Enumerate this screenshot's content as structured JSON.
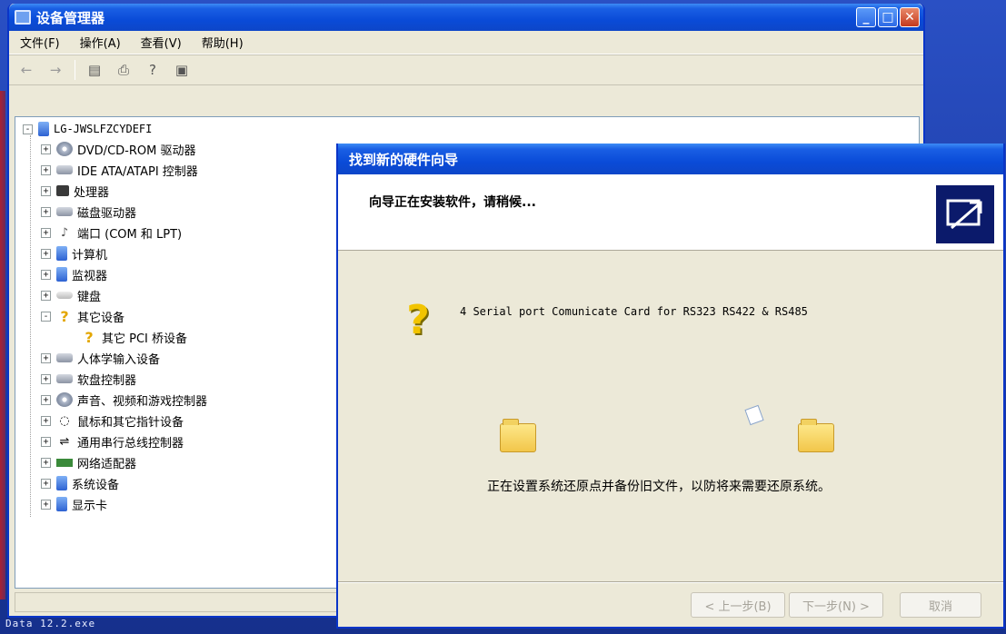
{
  "device_manager": {
    "title": "设备管理器",
    "menu": [
      "文件(F)",
      "操作(A)",
      "查看(V)",
      "帮助(H)"
    ],
    "toolbar": {
      "back_icon": "back-arrow-icon",
      "forward_icon": "forward-arrow-icon",
      "icons": [
        "properties-icon",
        "print-icon",
        "help-icon",
        "refresh-icon"
      ]
    },
    "tree": {
      "root": "LG-JWSLFZCYDEFI",
      "items": [
        {
          "label": "DVD/CD-ROM 驱动器",
          "icon": "disk-icon",
          "expander": "+"
        },
        {
          "label": "IDE ATA/ATAPI 控制器",
          "icon": "drive-icon",
          "expander": "+"
        },
        {
          "label": "处理器",
          "icon": "chip-icon",
          "expander": "+"
        },
        {
          "label": "磁盘驱动器",
          "icon": "drive-icon",
          "expander": "+"
        },
        {
          "label": "端口 (COM 和 LPT)",
          "icon": "port-icon",
          "expander": "+"
        },
        {
          "label": "计算机",
          "icon": "monitor-icon",
          "expander": "+"
        },
        {
          "label": "监视器",
          "icon": "monitor-icon",
          "expander": "+"
        },
        {
          "label": "键盘",
          "icon": "keyboard-icon",
          "expander": "+"
        },
        {
          "label": "其它设备",
          "icon": "question-icon",
          "expander": "-"
        },
        {
          "label": "其它 PCI 桥设备",
          "icon": "question-icon",
          "expander": ""
        },
        {
          "label": "人体学输入设备",
          "icon": "hid-icon",
          "expander": "+"
        },
        {
          "label": "软盘控制器",
          "icon": "drive-icon",
          "expander": "+"
        },
        {
          "label": "声音、视频和游戏控制器",
          "icon": "sound-icon",
          "expander": "+"
        },
        {
          "label": "鼠标和其它指针设备",
          "icon": "mouse-icon",
          "expander": "+"
        },
        {
          "label": "通用串行总线控制器",
          "icon": "usb-icon",
          "expander": "+"
        },
        {
          "label": "网络适配器",
          "icon": "network-icon",
          "expander": "+"
        },
        {
          "label": "系统设备",
          "icon": "monitor-icon",
          "expander": "+"
        },
        {
          "label": "显示卡",
          "icon": "monitor-icon",
          "expander": "+"
        }
      ]
    }
  },
  "wizard": {
    "title": "找到新的硬件向导",
    "header": "向导正在安装软件，请稍候...",
    "device_name": "4 Serial port Comunicate Card for RS323 RS422 & RS485",
    "status_text": "正在设置系统还原点并备份旧文件，以防将来需要还原系统。",
    "buttons": {
      "back": "< 上一步(B)",
      "next": "下一步(N) >",
      "cancel": "取消"
    }
  },
  "desktop": {
    "caption": "Data    12.2.exe"
  },
  "colors": {
    "title_blue": "#0a4bd8",
    "window_bg": "#ece9d8",
    "question_yellow": "#f2c400"
  }
}
